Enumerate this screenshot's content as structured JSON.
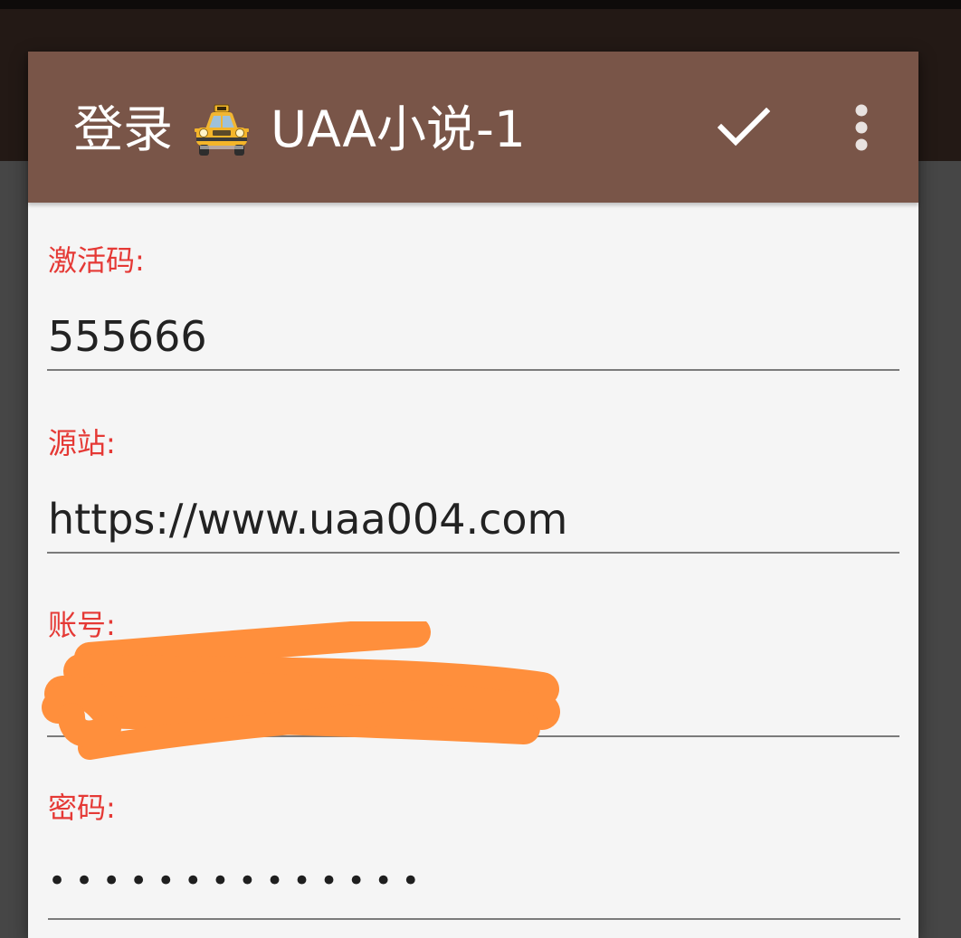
{
  "dialog": {
    "title_prefix": "登录",
    "title_icon": "taxi-icon",
    "title_suffix": "UAA小说-1",
    "actions": {
      "confirm_icon": "check-icon",
      "more_icon": "more-vert-icon"
    }
  },
  "fields": {
    "activation_code": {
      "label": "激活码:",
      "value": "555666"
    },
    "source_site": {
      "label": "源站:",
      "value": "https://www.uaa004.com"
    },
    "account": {
      "label": "账号:",
      "value": "",
      "redacted": true
    },
    "password": {
      "label": "密码:",
      "masked_value": "••••••••••••••"
    }
  },
  "colors": {
    "toolbar": "#795548",
    "label": "#e53935",
    "redaction": "#ff8f3c"
  }
}
